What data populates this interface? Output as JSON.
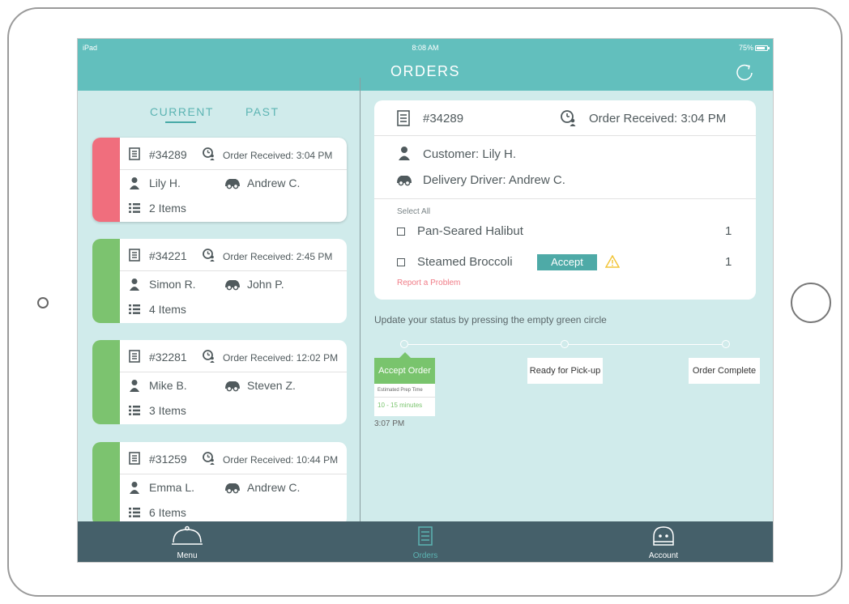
{
  "status_bar": {
    "device": "iPad",
    "time": "8:08 AM",
    "battery": "75%"
  },
  "header": {
    "title": "ORDERS"
  },
  "tabs": {
    "current": "CURRENT",
    "past": "PAST"
  },
  "orders": [
    {
      "number": "#34289",
      "received": "Order Received: 3:04 PM",
      "customer": "Lily H.",
      "driver": "Andrew C.",
      "items": "2 Items",
      "status_color": "#f06e7d"
    },
    {
      "number": "#34221",
      "received": "Order Received: 2:45 PM",
      "customer": "Simon R.",
      "driver": "John P.",
      "items": "4 Items",
      "status_color": "#7cc36f"
    },
    {
      "number": "#32281",
      "received": "Order Received: 12:02 PM",
      "customer": "Mike B.",
      "driver": "Steven Z.",
      "items": "3 Items",
      "status_color": "#7cc36f"
    },
    {
      "number": "#31259",
      "received": "Order Received: 10:44 PM",
      "customer": "Emma L.",
      "driver": "Andrew C.",
      "items": "6 Items",
      "status_color": "#7cc36f"
    }
  ],
  "detail": {
    "number": "#34289",
    "received": "Order Received: 3:04 PM",
    "customer": "Customer: Lily H.",
    "driver": "Delivery Driver: Andrew C.",
    "select_all": "Select All",
    "items": [
      {
        "name": "Pan-Seared Halibut",
        "qty": "1"
      },
      {
        "name": "Steamed Broccoli",
        "qty": "1"
      }
    ],
    "accept_label": "Accept",
    "report_label": "Report a Problem"
  },
  "status_tracker": {
    "instruction": "Update your status by pressing the empty green circle",
    "stages": [
      "Accept Order",
      "Ready for Pick-up",
      "Order Complete"
    ],
    "prep_label": "Estimated Prep Time",
    "prep_value": "10 - 15 minutes",
    "accepted_time": "3:07 PM"
  },
  "tabbar": {
    "menu": "Menu",
    "orders": "Orders",
    "account": "Account"
  },
  "colors": {
    "header": "#62bfbd",
    "background": "#d0ebeb",
    "accent": "#4eaaa7",
    "tabbar": "#45606a"
  }
}
